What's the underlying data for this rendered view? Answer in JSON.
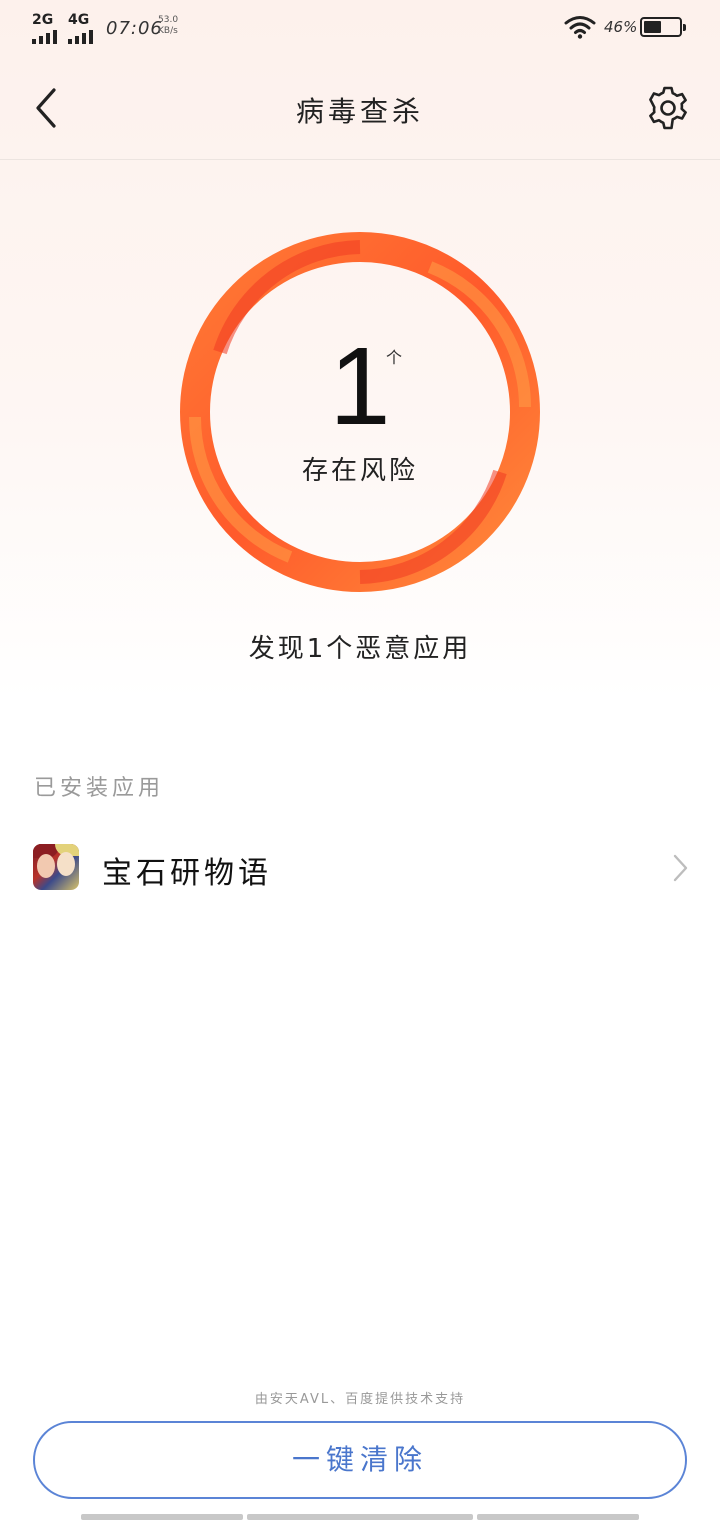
{
  "status_bar": {
    "network1": "2G",
    "network2": "4G",
    "time": "07:06",
    "speed_value": "53.0",
    "speed_unit": "KB/s",
    "battery_percent": "46%",
    "battery_level": 0.46
  },
  "header": {
    "title": "病毒查杀",
    "back_icon": "chevron-left-icon",
    "settings_icon": "gear-icon"
  },
  "scan_result": {
    "count": "1",
    "unit": "个",
    "status": "存在风险",
    "summary": "发现1个恶意应用",
    "ring_colors": [
      "#ff5a2b",
      "#ff8a3a",
      "#f03a22"
    ]
  },
  "installed_apps": {
    "section_label": "已安装应用",
    "items": [
      {
        "name": "宝石研物语"
      }
    ]
  },
  "footer": {
    "powered_by": "由安天AVL、百度提供技术支持",
    "clean_button": "一键清除",
    "accent": "#4a76cc"
  }
}
